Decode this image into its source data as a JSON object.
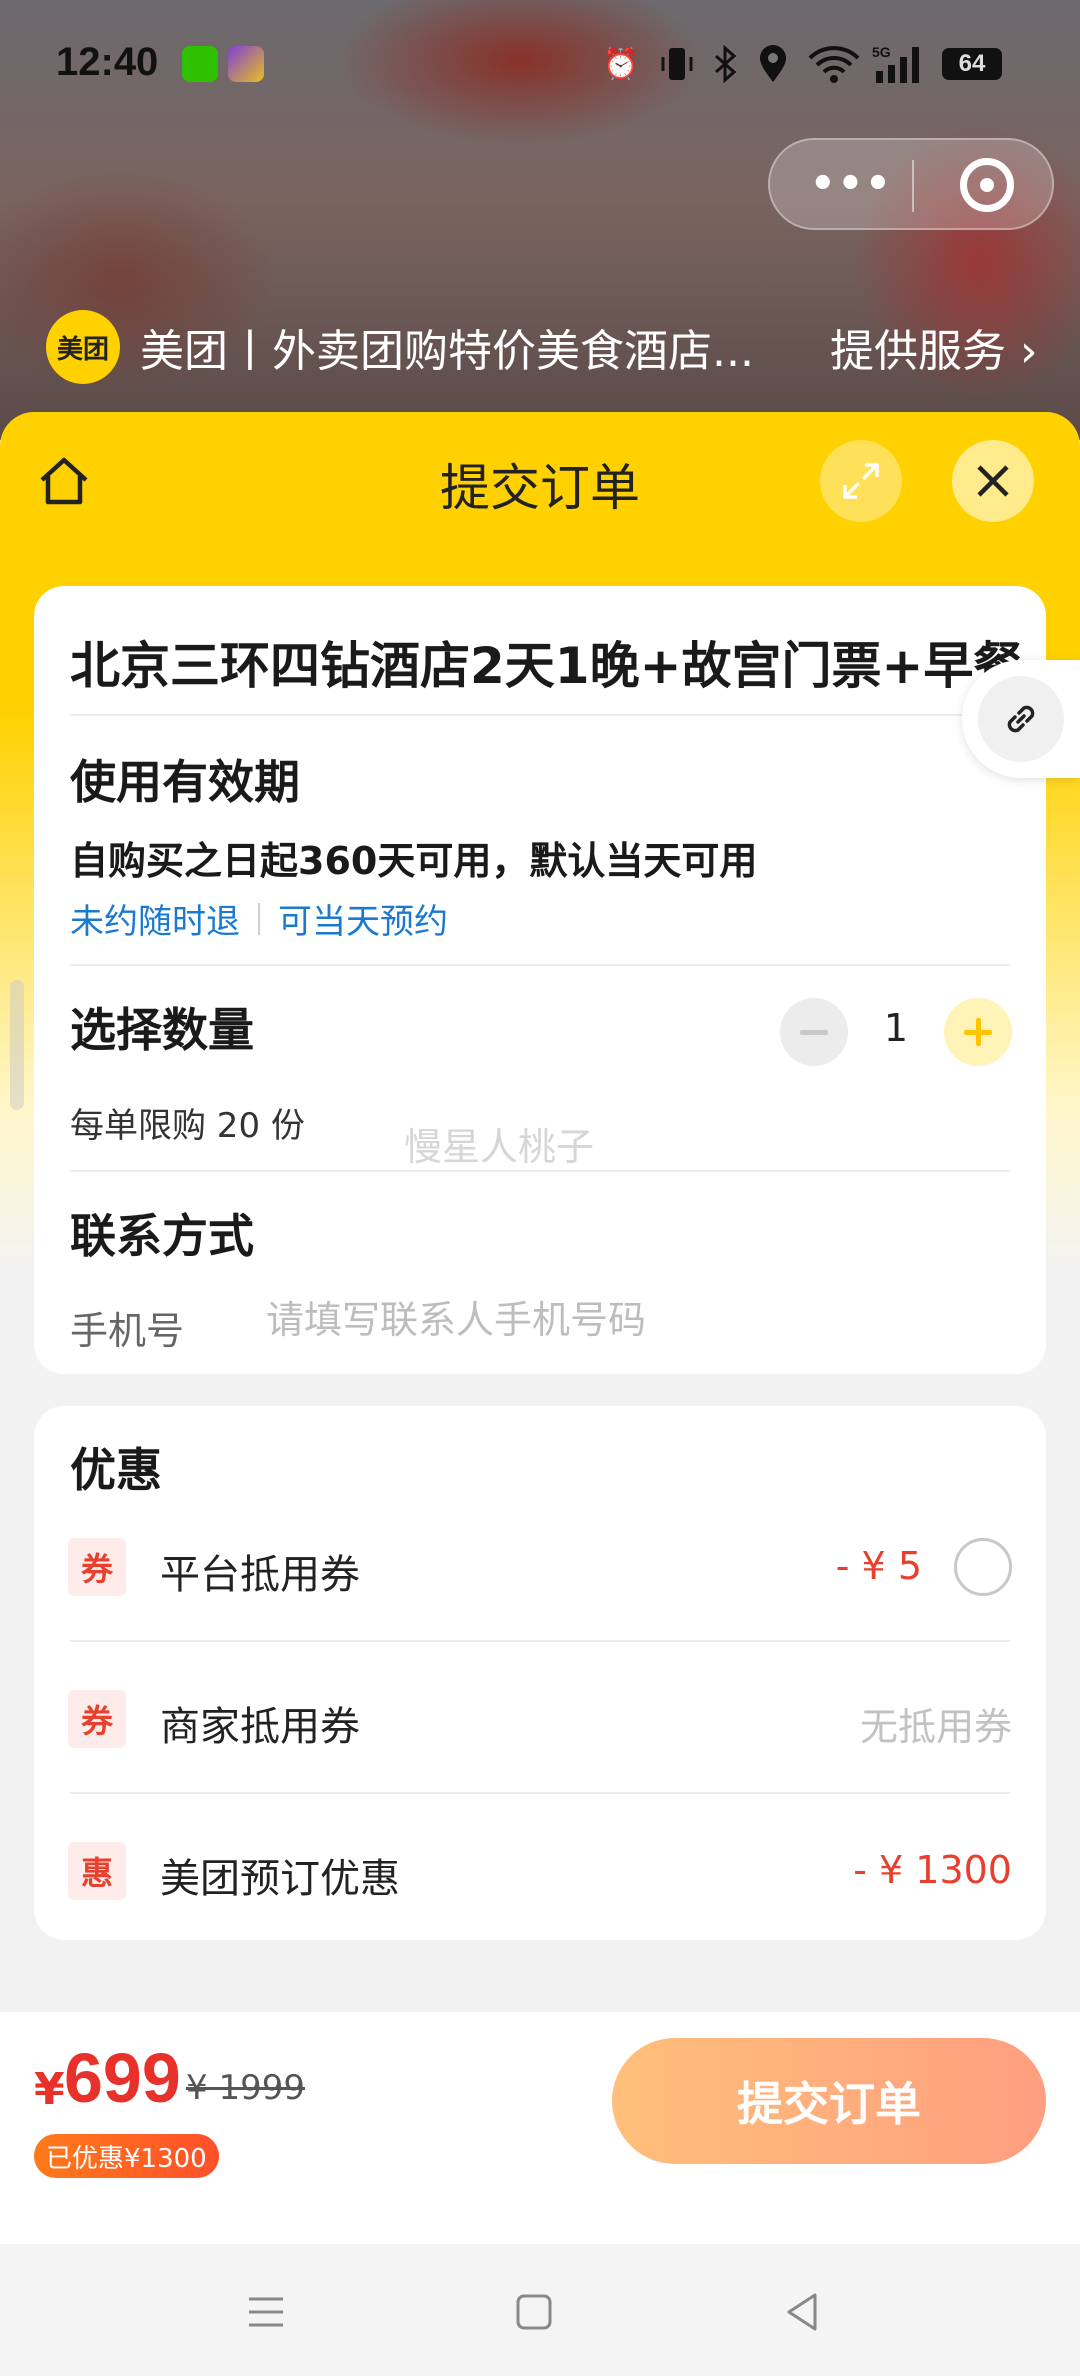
{
  "status_bar": {
    "time": "12:40",
    "battery": "64",
    "icons": [
      "wechat-icon",
      "game-app-icon",
      "alarm-icon",
      "vibrate-icon",
      "bluetooth-icon",
      "location-icon",
      "wifi-icon",
      "signal-5g-icon",
      "battery-icon"
    ]
  },
  "mini_program": {
    "provider_logo": "美团",
    "provider_name": "美团丨外卖团购特价美食酒店...",
    "service_link": "提供服务",
    "capsule_icons": [
      "more-dots-icon",
      "close-target-icon"
    ]
  },
  "sheet": {
    "title": "提交订单",
    "icons": [
      "home-icon",
      "expand-icon",
      "close-icon"
    ]
  },
  "product": {
    "title": "北京三环四钻酒店2天1晚+故宫门票+早餐",
    "validity_heading": "使用有效期",
    "validity_text": "自购买之日起360天可用，默认当天可用",
    "tags": [
      "未约随时退",
      "可当天预约"
    ],
    "quantity_heading": "选择数量",
    "quantity": "1",
    "limit_text": "每单限购 20 份",
    "watermark": "慢星人桃子",
    "contact_heading": "联系方式",
    "phone_label": "手机号",
    "phone_placeholder": "请填写联系人手机号码"
  },
  "discounts": {
    "heading": "优惠",
    "rows": [
      {
        "badge": "券",
        "label": "平台抵用券",
        "value": "- ¥ 5"
      },
      {
        "badge": "券",
        "label": "商家抵用券",
        "value": "无抵用券"
      },
      {
        "badge": "惠",
        "label": "美团预订优惠",
        "value": "- ¥ 1300"
      }
    ]
  },
  "checkout": {
    "currency": "¥",
    "price": "699",
    "original_price": "¥ 1999",
    "saved_badge": "已优惠¥1300",
    "submit_label": "提交订单"
  },
  "colors": {
    "brand_yellow": "#ffd100",
    "price_red": "#e8312a",
    "link_blue": "#1a7ad0",
    "submit_gradient_start": "#ffbf7a",
    "submit_gradient_end": "#ff9e80"
  }
}
